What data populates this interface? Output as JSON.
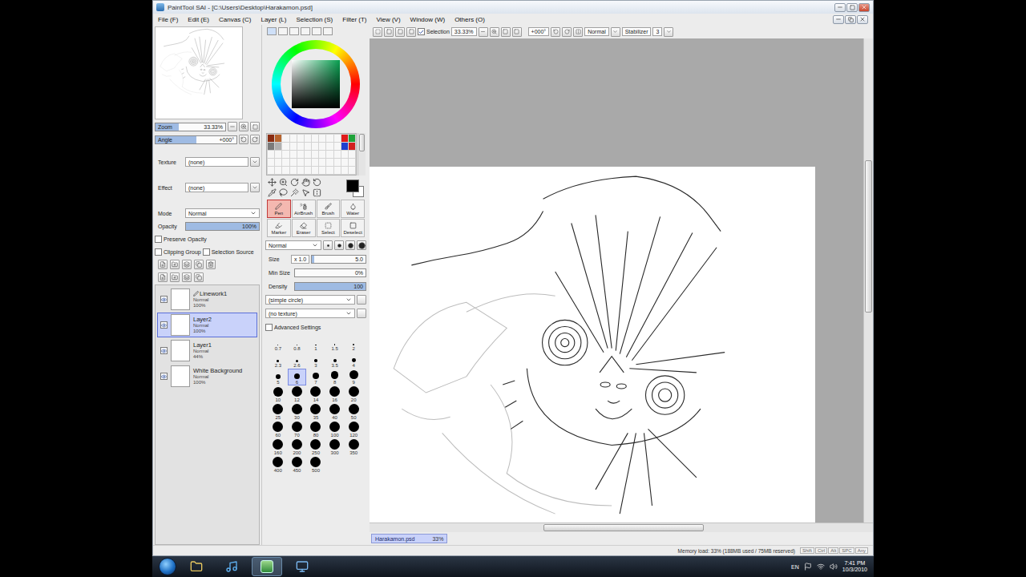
{
  "window": {
    "title": "PaintTool SAI - [C:\\Users\\Desktop\\Harakamon.psd]"
  },
  "menu": [
    {
      "label": "File (F)"
    },
    {
      "label": "Edit (E)"
    },
    {
      "label": "Canvas (C)"
    },
    {
      "label": "Layer (L)"
    },
    {
      "label": "Selection (S)"
    },
    {
      "label": "Filter (T)"
    },
    {
      "label": "View (V)"
    },
    {
      "label": "Window (W)"
    },
    {
      "label": "Others (O)"
    }
  ],
  "toolbar": {
    "selection": {
      "label": "Selection",
      "checked": true
    },
    "zoom": "33.33%",
    "angle": "+000°",
    "view_mode": "Normal",
    "stabilizer": {
      "label": "Stabilizer",
      "value": "3"
    }
  },
  "navigator": {
    "zoom": {
      "label": "Zoom",
      "value": "33.33%",
      "level": 0.33
    },
    "angle": {
      "label": "Angle",
      "value": "+000°",
      "level": 0.5
    }
  },
  "paper": [
    {
      "label": "Texture",
      "value": "(none)"
    },
    {
      "label": "Effect",
      "value": "(none)"
    }
  ],
  "layer_props": {
    "mode": {
      "label": "Mode",
      "value": "Normal"
    },
    "opacity": {
      "label": "Opacity",
      "value": "100%",
      "level": 1
    },
    "options": [
      {
        "label": "Preserve Opacity",
        "checked": false
      },
      {
        "label": "Clipping Group",
        "checked": false
      },
      {
        "label": "Selection Source",
        "checked": false
      }
    ]
  },
  "layers": [
    {
      "name": "Linework1",
      "kind": "linework",
      "mode": "Normal",
      "opacity": "100%",
      "visible": true,
      "selected": false
    },
    {
      "name": "Layer2",
      "kind": "raster",
      "mode": "Normal",
      "opacity": "100%",
      "visible": true,
      "selected": true
    },
    {
      "name": "Layer1",
      "kind": "raster",
      "mode": "Normal",
      "opacity": "44%",
      "visible": true,
      "selected": false
    },
    {
      "name": "White Background",
      "kind": "raster",
      "mode": "Normal",
      "opacity": "100%",
      "visible": true,
      "selected": false
    }
  ],
  "current_color": {
    "color": "#000000"
  },
  "swatches": [
    {
      "color": "#8a2d12",
      "empty": false
    },
    {
      "color": "#b8642e",
      "empty": false
    },
    {
      "color": "#f7f7f7",
      "empty": true
    },
    {
      "color": "#f7f7f7",
      "empty": true
    },
    {
      "color": "#f7f7f7",
      "empty": true
    },
    {
      "color": "#f7f7f7",
      "empty": true
    },
    {
      "color": "#f7f7f7",
      "empty": true
    },
    {
      "color": "#f7f7f7",
      "empty": true
    },
    {
      "color": "#f7f7f7",
      "empty": true
    },
    {
      "color": "#f7f7f7",
      "empty": true
    },
    {
      "color": "#e01b1b",
      "empty": false
    },
    {
      "color": "#1fa33a",
      "empty": false
    },
    {
      "color": "#7a7a7a",
      "empty": false
    },
    {
      "color": "#b0b0b0",
      "empty": false
    },
    {
      "color": "#f7f7f7",
      "empty": true
    },
    {
      "color": "#f7f7f7",
      "empty": true
    },
    {
      "color": "#f7f7f7",
      "empty": true
    },
    {
      "color": "#f7f7f7",
      "empty": true
    },
    {
      "color": "#f7f7f7",
      "empty": true
    },
    {
      "color": "#f7f7f7",
      "empty": true
    },
    {
      "color": "#f7f7f7",
      "empty": true
    },
    {
      "color": "#f7f7f7",
      "empty": true
    },
    {
      "color": "#1f3fd0",
      "empty": false
    },
    {
      "color": "#d21f1f",
      "empty": false
    }
  ],
  "tools": [
    {
      "label": "Pen",
      "selected": true
    },
    {
      "label": "AirBrush",
      "selected": false
    },
    {
      "label": "Brush",
      "selected": false
    },
    {
      "label": "Water",
      "selected": false
    },
    {
      "label": "Marker",
      "selected": false
    },
    {
      "label": "Eraser",
      "selected": false
    },
    {
      "label": "Select",
      "selected": false
    },
    {
      "label": "Deselect",
      "selected": false
    }
  ],
  "brush": {
    "mode": "Normal",
    "size": {
      "label": "Size",
      "multiplier": "x 1.0",
      "value": "5.0",
      "level": 0.05
    },
    "min_size": {
      "label": "Min Size",
      "value": "0%",
      "level": 0
    },
    "density": {
      "label": "Density",
      "value": "100",
      "level": 1
    },
    "shape": "(simple circle)",
    "texture": "(no texture)",
    "advanced": {
      "label": "Advanced Settings",
      "checked": false
    }
  },
  "brush_sizes": [
    {
      "label": "0.7",
      "selected": false
    },
    {
      "label": "0.8",
      "selected": false
    },
    {
      "label": "1",
      "selected": false
    },
    {
      "label": "1.5",
      "selected": false
    },
    {
      "label": "2",
      "selected": false
    },
    {
      "label": "2.3",
      "selected": false
    },
    {
      "label": "2.6",
      "selected": false
    },
    {
      "label": "3",
      "selected": false
    },
    {
      "label": "3.5",
      "selected": false
    },
    {
      "label": "4",
      "selected": false
    },
    {
      "label": "5",
      "selected": false
    },
    {
      "label": "6",
      "selected": true
    },
    {
      "label": "7",
      "selected": false
    },
    {
      "label": "8",
      "selected": false
    },
    {
      "label": "9",
      "selected": false
    },
    {
      "label": "10",
      "selected": false
    },
    {
      "label": "12",
      "selected": false
    },
    {
      "label": "14",
      "selected": false
    },
    {
      "label": "16",
      "selected": false
    },
    {
      "label": "20",
      "selected": false
    },
    {
      "label": "25",
      "selected": false
    },
    {
      "label": "30",
      "selected": false
    },
    {
      "label": "35",
      "selected": false
    },
    {
      "label": "40",
      "selected": false
    },
    {
      "label": "50",
      "selected": false
    },
    {
      "label": "60",
      "selected": false
    },
    {
      "label": "70",
      "selected": false
    },
    {
      "label": "80",
      "selected": false
    },
    {
      "label": "100",
      "selected": false
    },
    {
      "label": "120",
      "selected": false
    },
    {
      "label": "160",
      "selected": false
    },
    {
      "label": "200",
      "selected": false
    },
    {
      "label": "250",
      "selected": false
    },
    {
      "label": "300",
      "selected": false
    },
    {
      "label": "350",
      "selected": false
    },
    {
      "label": "400",
      "selected": false
    },
    {
      "label": "450",
      "selected": false
    },
    {
      "label": "500",
      "selected": false
    }
  ],
  "document_tabs": [
    {
      "name": "Harakamon.psd",
      "zoom": "33%",
      "selected": true
    }
  ],
  "status_bar": {
    "memory": "Memory load: 33% (188MB used / 75MB reserved)",
    "keys": [
      "Shift",
      "Ctrl",
      "Alt",
      "SPC",
      "Any"
    ]
  },
  "taskbar": {
    "apps": [
      {
        "kind": "folder",
        "selected": false
      },
      {
        "kind": "music",
        "selected": false
      },
      {
        "kind": "sai",
        "selected": true
      },
      {
        "kind": "screen",
        "selected": false
      }
    ],
    "language": "EN",
    "time": "7:41 PM",
    "date": "10/3/2010"
  }
}
